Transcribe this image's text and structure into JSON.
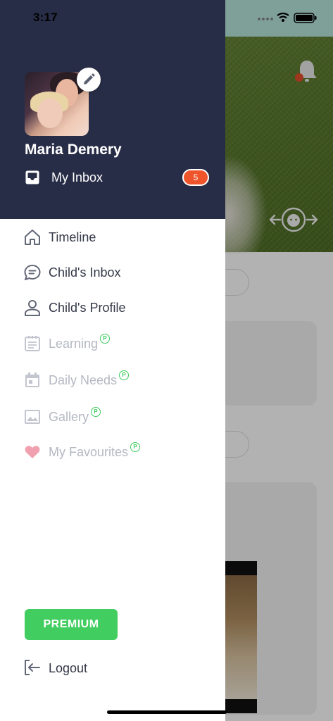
{
  "status_bar": {
    "time": "3:17"
  },
  "drawer": {
    "user_name": "Maria Demery",
    "inbox": {
      "label": "My Inbox",
      "badge_count": "5"
    },
    "menu_items": [
      {
        "label": "Timeline",
        "icon": "home-icon",
        "enabled": true,
        "premium": false
      },
      {
        "label": "Child's Inbox",
        "icon": "chat-bubble-icon",
        "enabled": true,
        "premium": false
      },
      {
        "label": "Child's Profile",
        "icon": "person-icon",
        "enabled": true,
        "premium": false
      },
      {
        "label": "Learning",
        "icon": "notepad-icon",
        "enabled": false,
        "premium": true
      },
      {
        "label": "Daily Needs",
        "icon": "calendar-icon",
        "enabled": false,
        "premium": true
      },
      {
        "label": "Gallery",
        "icon": "image-icon",
        "enabled": false,
        "premium": true
      },
      {
        "label": "My Favourites",
        "icon": "heart-icon",
        "enabled": false,
        "premium": true
      }
    ],
    "premium_marker": "P",
    "premium_button": "PREMIUM",
    "logout_label": "Logout"
  },
  "colors": {
    "header_bg": "#282d47",
    "premium_green": "#41cd5f",
    "badge_orange": "#f0542b",
    "active_text": "#333847",
    "disabled_text": "#b5b8c2",
    "heart_pink": "#f0a0ae"
  }
}
